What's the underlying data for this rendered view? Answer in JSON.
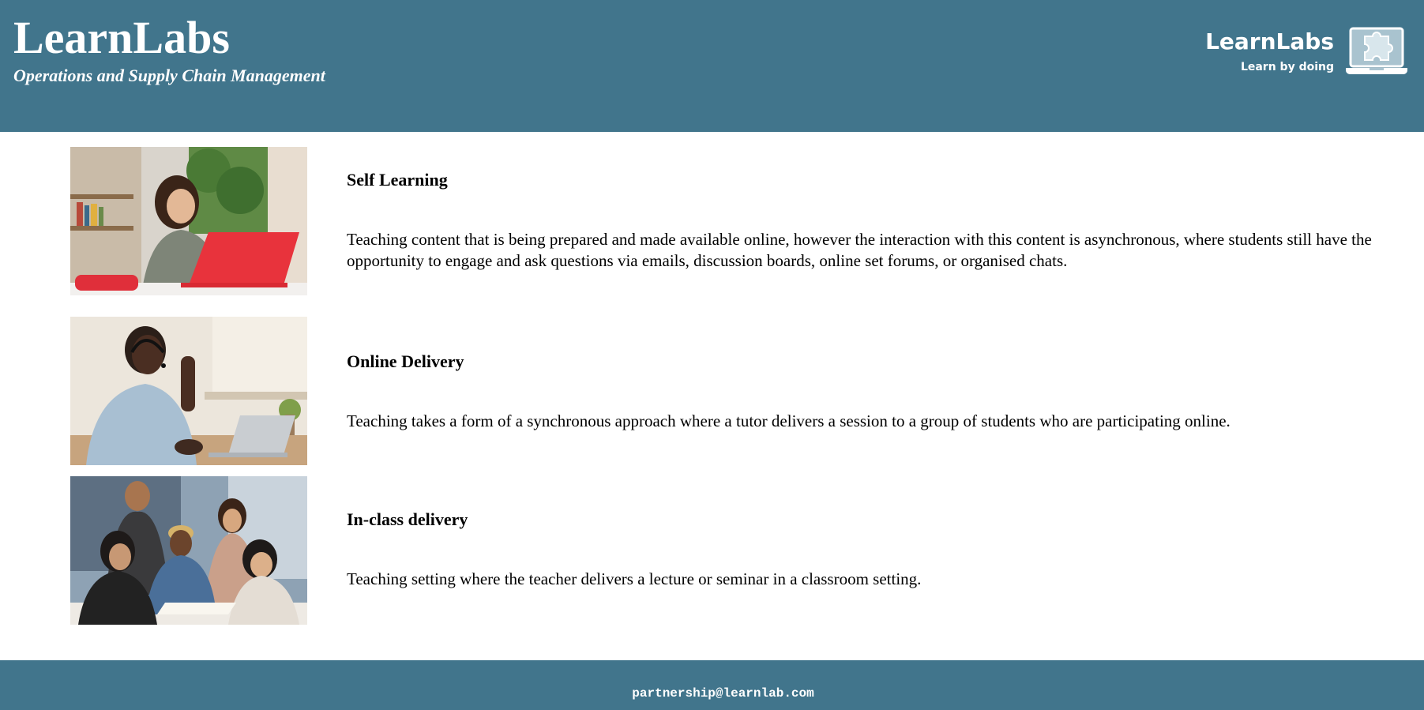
{
  "header": {
    "title": "LearnLabs",
    "subtitle": "Operations and Supply Chain Management",
    "logo": {
      "name": "LearnLabs",
      "tagline": "Learn by doing",
      "icon": "laptop-puzzle-icon"
    }
  },
  "main": {
    "items": [
      {
        "title": "Self Learning",
        "description": "Teaching content that is being prepared and made available online, however the interaction with this content is asynchronous, where students still have the opportunity to engage and ask questions via emails, discussion boards, online set forums, or organised chats.",
        "image": "student-with-laptop-photo"
      },
      {
        "title": "Online Delivery",
        "description": "Teaching takes a form of a synchronous approach where a tutor delivers a session to a group of students who are participating online.",
        "image": "student-waving-at-laptop-photo"
      },
      {
        "title": "In-class delivery",
        "description": "Teaching setting where the teacher delivers a lecture or seminar in a classroom setting.",
        "image": "group-of-students-photo"
      }
    ]
  },
  "footer": {
    "email": "partnership@learnlab.com"
  },
  "colors": {
    "brand": "#41758c",
    "background": "#ffffff",
    "text": "#000000"
  }
}
